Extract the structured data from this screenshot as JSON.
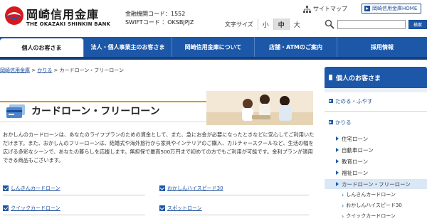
{
  "header": {
    "logo_jp": "岡崎信用金庫",
    "logo_en": "THE OKAZAKI SHINKIN BANK",
    "bank_code": "金融機関コード：1552",
    "swift_code": "SWIFTコード ：OKSBJPJZ",
    "font_size_label": "文字サイズ",
    "font_sizes": [
      "小",
      "中",
      "大"
    ],
    "sitemap_label": "サイトマップ",
    "home_label": "岡崎信用金庫HOME",
    "search_button": "検索",
    "search_placeholder": ""
  },
  "nav": {
    "tabs": [
      {
        "label": "個人のお客さま",
        "active": true
      },
      {
        "label": "法人・個人事業主のお客さま",
        "active": false
      },
      {
        "label": "岡崎信用金庫について",
        "active": false
      },
      {
        "label": "店舗・ATMのご案内",
        "active": false
      },
      {
        "label": "採用情報",
        "active": false
      }
    ]
  },
  "breadcrumb": {
    "items": [
      "岡崎信用金庫",
      "かりる",
      "カードローン・フリーローン"
    ],
    "separator": " > "
  },
  "main": {
    "title": "カードローン・フリーローン",
    "intro": "おかしんのカードローンは、あなたのライフプランのための資金として、また、急にお金が必要になったときなどに安心してご利用いただけます。また、おかしんのフリーローンは、結婚式や海外旅行から家具やインテリアのご購入、カルチャースクールなど、生活の幅を広げる多彩なシーンで、あなたの暮らしを応援します。無担保で最高500万円まで初めての方でもご利用が可能です。金利プランが適用できる商品もございます。",
    "links": [
      {
        "label": "しんきんカードローン"
      },
      {
        "label": "おかしんハイスピード30"
      },
      {
        "label": "クイックカードローン"
      },
      {
        "label": "スポットローン"
      }
    ]
  },
  "sidebar": {
    "heading": "個人のお客さま",
    "items": [
      {
        "label": "たのる・ふやす"
      },
      {
        "label": "かりる"
      },
      {
        "label": "住宅ローン"
      },
      {
        "label": "自動車ローン"
      },
      {
        "label": "教育ローン"
      },
      {
        "label": "福祉ローン"
      },
      {
        "label": "カードローン・フリーローン"
      },
      {
        "label": "しんきんカードローン"
      },
      {
        "label": "おかしんハイスピード30"
      },
      {
        "label": "クイックカードローン"
      }
    ]
  },
  "colors": {
    "nav_blue": "#1d58a8",
    "accent_orange": "#e6931e",
    "logo_red": "#d7191f"
  }
}
